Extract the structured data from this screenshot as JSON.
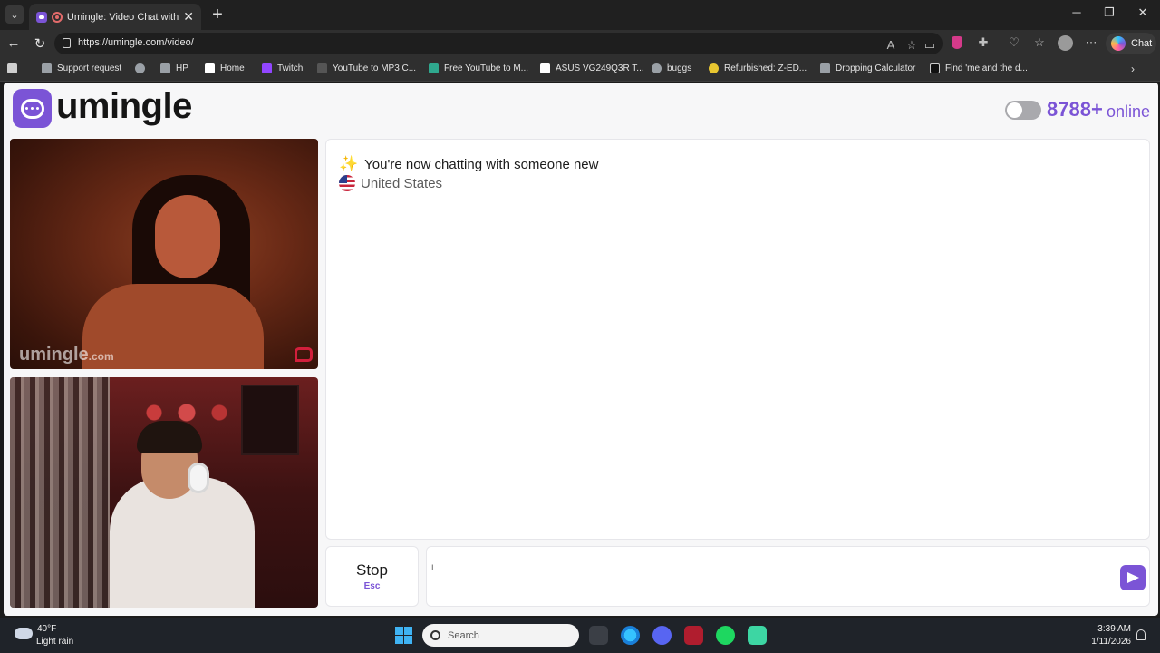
{
  "browser": {
    "tab_title": "Umingle: Video Chat with Stra",
    "url": "https://umingle.com/video/",
    "copilot_label": "Chat",
    "bookmarks": [
      {
        "label": "Support request"
      },
      {
        "label": ""
      },
      {
        "label": "HP"
      },
      {
        "label": "Home"
      },
      {
        "label": "Twitch"
      },
      {
        "label": "YouTube to MP3 C..."
      },
      {
        "label": "Free YouTube to M..."
      },
      {
        "label": "ASUS VG249Q3R T..."
      },
      {
        "label": "buggs"
      },
      {
        "label": "Refurbished: Z-ED..."
      },
      {
        "label": "Dropping Calculator"
      },
      {
        "label": "Find 'me and the d..."
      }
    ]
  },
  "site": {
    "logo_text": "umingle",
    "online_count": "8788+",
    "online_label": "online",
    "accent": "#7b54d6"
  },
  "video": {
    "watermark": "umingle",
    "watermark_suffix": ".com"
  },
  "chat": {
    "status_message": "You're now chatting with someone new",
    "country": "United States"
  },
  "controls": {
    "stop_label": "Stop",
    "stop_shortcut": "Esc"
  },
  "taskbar": {
    "temperature": "40°F",
    "condition": "Light rain",
    "search_label": "Search",
    "time": "3:39 AM",
    "date": "1/11/2026"
  }
}
